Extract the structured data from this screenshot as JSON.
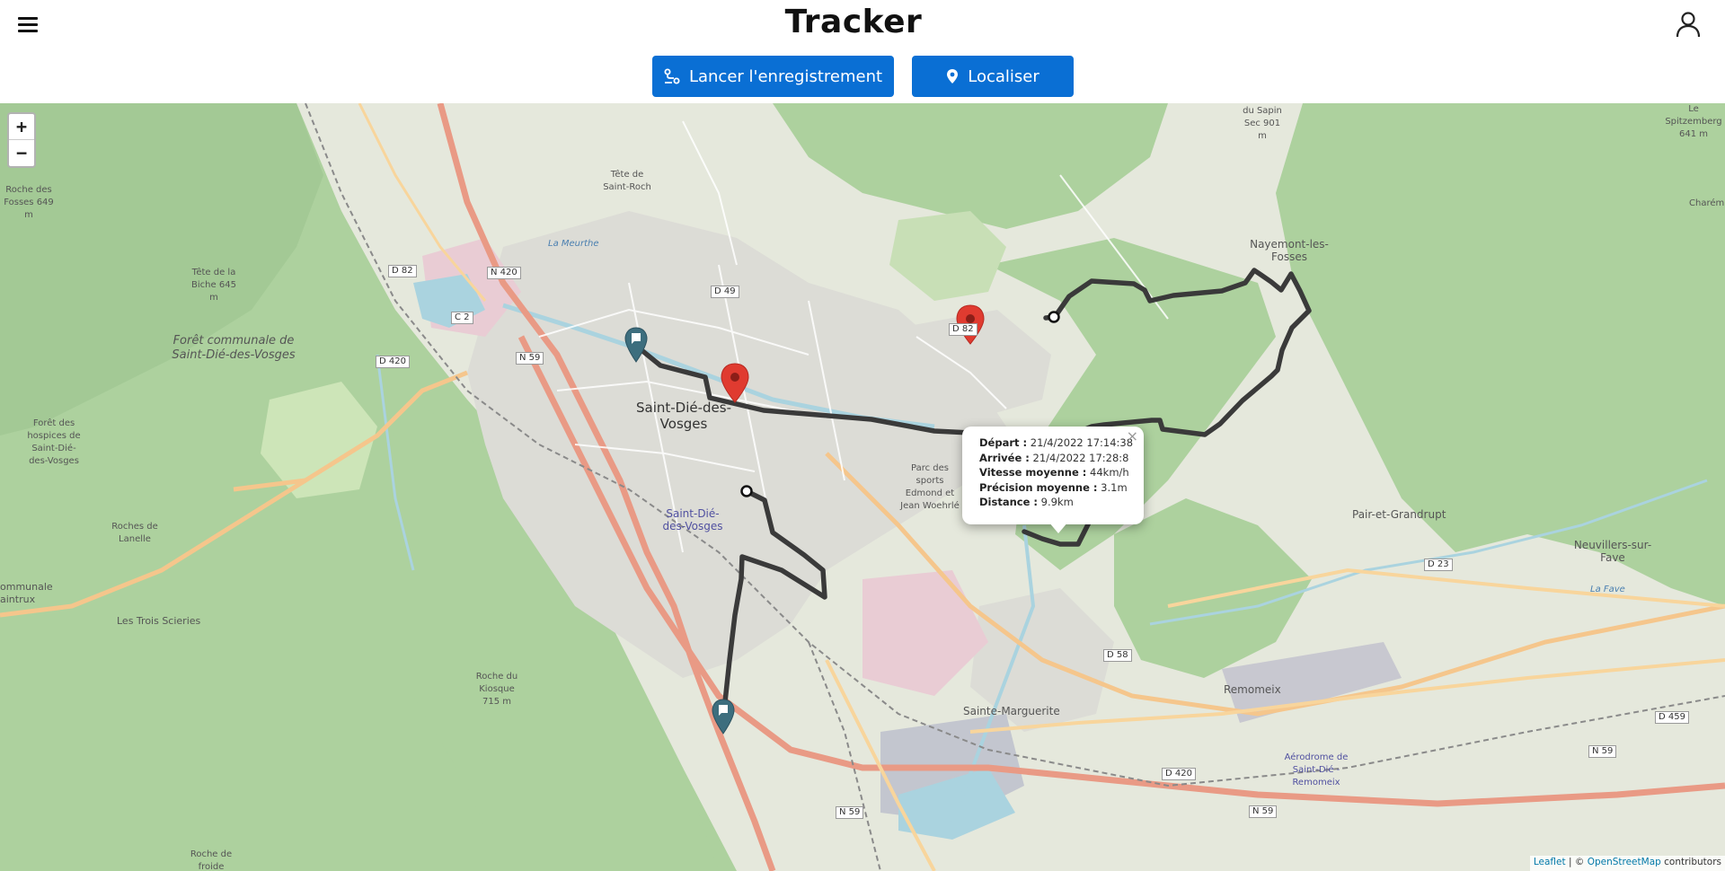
{
  "header": {
    "title": "Tracker",
    "record_label": "Lancer l'enregistrement",
    "locate_label": "Localiser"
  },
  "icons": {
    "menu": "hamburger-icon",
    "user": "user-icon",
    "record": "route-icon",
    "locate": "map-pin-icon"
  },
  "colors": {
    "primary": "#0a6fd4",
    "track": "#3a3a3a",
    "marker_red": "#e03b30",
    "marker_teal": "#3d6e7e"
  },
  "map": {
    "zoom_in": "+",
    "zoom_out": "−",
    "labels": {
      "saint_die": "Saint-Dié-des-Vosges",
      "saint_die_station": "Saint-Dié-des-Vosges",
      "foret_communale": "Forêt communale de Saint-Dié-des-Vosges",
      "foret_hospices": "Forêt des hospices de Saint-Dié-des-Vosges",
      "nayemont": "Nayemont-les-Fosses",
      "pair_grandrupt": "Pair-et-Grandrupt",
      "neuvillers": "Neuvillers-sur-Fave",
      "sainte_marguerite": "Sainte-Marguerite",
      "remomeix": "Remomeix",
      "trois_scieries": "Les Trois Scieries",
      "roches_lanelle": "Roches de Lanelle",
      "tete_biche": "Tête de la Biche 645 m",
      "roche_fosses": "Roche des Fosses 649 m",
      "tete_saint_roch": "Tête de Saint-Roch",
      "roche_kiosque": "Roche du Kiosque 715 m",
      "aerodrome": "Aérodrome de Saint-Dié - Remomeix",
      "parc_sports": "Parc des sports Edmond et Jean Woehrlé",
      "sapin_sec": "du Sapin Sec 901 m",
      "spitzemberg": "Le Spitzemberg 641 m",
      "charemont": "Charém",
      "communale_raintrux": "ommunale aintrux",
      "roche_froide": "Roche de froide",
      "la_meurthe": "La Meurthe",
      "la_fave": "La Fave"
    },
    "roads": [
      "D 82",
      "N 420",
      "D 49",
      "C 2",
      "D 420",
      "N 59",
      "D 82",
      "D 23",
      "D 58",
      "D 420",
      "N 59",
      "N 59",
      "D 459",
      "N 59"
    ]
  },
  "popup": {
    "close": "×",
    "rows": [
      {
        "label": "Départ :",
        "value": "21/4/2022 17:14:38"
      },
      {
        "label": "Arrivée :",
        "value": "21/4/2022 17:28:8"
      },
      {
        "label": "Vitesse moyenne :",
        "value": "44km/h"
      },
      {
        "label": "Précision moyenne :",
        "value": "3.1m"
      },
      {
        "label": "Distance :",
        "value": "9.9km"
      }
    ]
  },
  "attribution": {
    "leaflet": "Leaflet",
    "separator": " | © ",
    "osm": "OpenStreetMap",
    "suffix": " contributors"
  }
}
